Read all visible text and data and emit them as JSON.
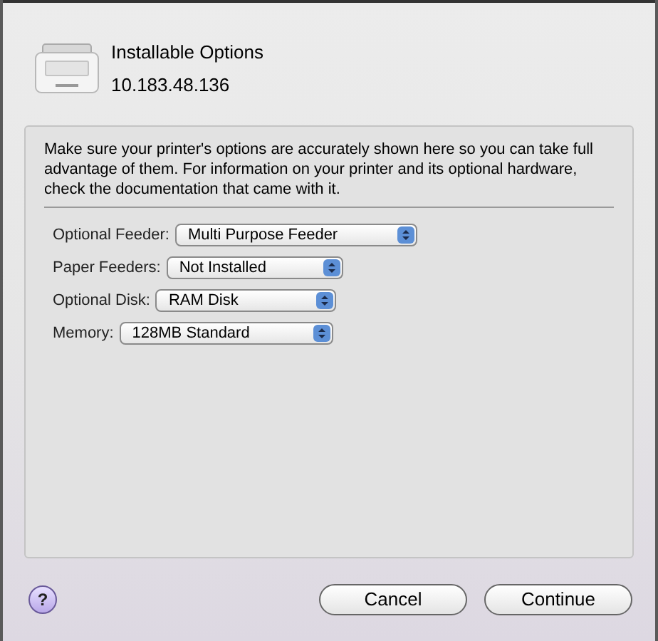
{
  "header": {
    "title": "Installable Options",
    "address": "10.183.48.136"
  },
  "message": "Make sure your printer's options are accurately shown here so you can take full advantage of them.  For information on your printer and its optional hardware, check the documentation that came with it.",
  "options": [
    {
      "label": "Optional Feeder:",
      "value": "Multi Purpose Feeder"
    },
    {
      "label": "Paper Feeders:",
      "value": "Not Installed"
    },
    {
      "label": "Optional Disk:",
      "value": "RAM Disk"
    },
    {
      "label": "Memory:",
      "value": "128MB Standard"
    }
  ],
  "help": "?",
  "buttons": [
    {
      "label": "Cancel",
      "default": false
    },
    {
      "label": "Continue",
      "default": false
    }
  ]
}
